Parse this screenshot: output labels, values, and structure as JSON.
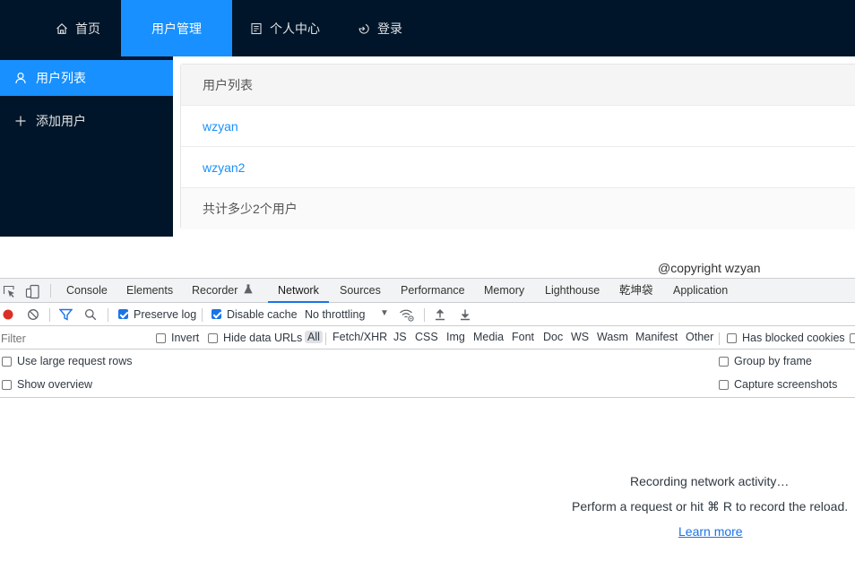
{
  "topnav": {
    "items": [
      {
        "label": "首页",
        "icon": "home-icon"
      },
      {
        "label": "用户管理",
        "icon": ""
      },
      {
        "label": "个人中心",
        "icon": "profile-icon"
      },
      {
        "label": "登录",
        "icon": "login-icon"
      }
    ],
    "active_index": 1
  },
  "sider": {
    "items": [
      {
        "label": "用户列表",
        "icon": "user-icon"
      },
      {
        "label": "添加用户",
        "icon": "plus-icon"
      }
    ]
  },
  "userlist": {
    "header": "用户列表",
    "users": [
      "wzyan",
      "wzyan2"
    ],
    "footer": "共计多少2个用户"
  },
  "copyright": "@copyright wzyan",
  "devtools": {
    "tabs": [
      "Console",
      "Elements",
      "Recorder",
      "Network",
      "Sources",
      "Performance",
      "Memory",
      "Lighthouse",
      "乾坤袋",
      "Application"
    ],
    "active_tab": "Network",
    "toolbar": {
      "preserve_log": "Preserve log",
      "disable_cache": "Disable cache",
      "throttling": "No throttling"
    },
    "filter": {
      "placeholder": "Filter",
      "invert": "Invert",
      "hide_data_urls": "Hide data URLs",
      "types": [
        "All",
        "Fetch/XHR",
        "JS",
        "CSS",
        "Img",
        "Media",
        "Font",
        "Doc",
        "WS",
        "Wasm",
        "Manifest",
        "Other"
      ],
      "has_blocked_cookies": "Has blocked cookies"
    },
    "options": {
      "large_rows": "Use large request rows",
      "show_overview": "Show overview",
      "group_by_frame": "Group by frame",
      "capture_screenshots": "Capture screenshots"
    },
    "empty": {
      "recording": "Recording network activity…",
      "hint": "Perform a request or hit ⌘ R to record the reload.",
      "learn_more": "Learn more"
    }
  },
  "colors": {
    "nav_bg": "#001529",
    "accent": "#1890ff",
    "devtools_accent": "#1a73e8"
  }
}
